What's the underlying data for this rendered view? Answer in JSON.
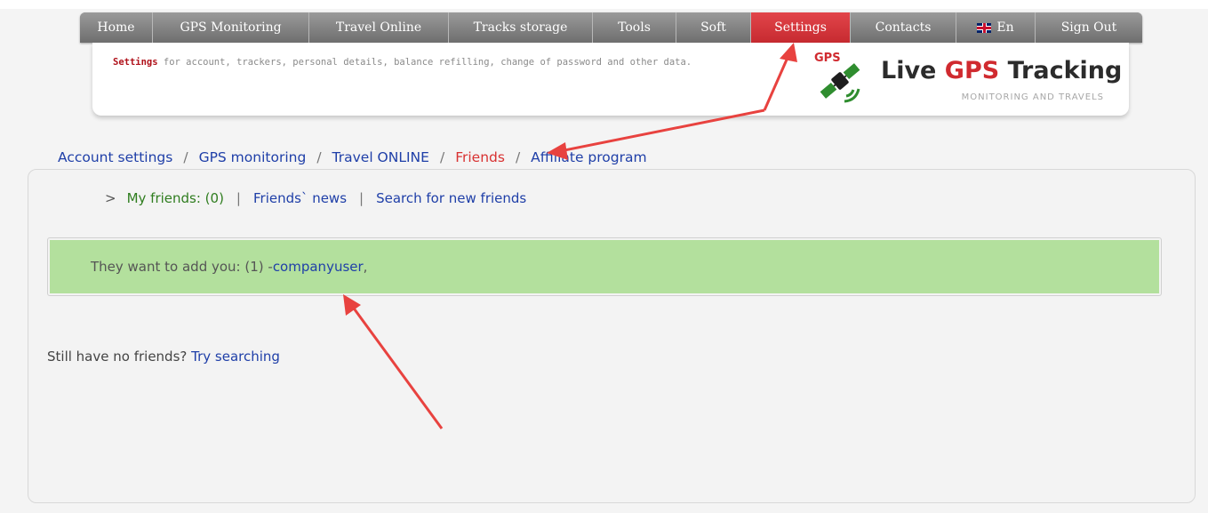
{
  "nav": {
    "items": [
      {
        "label": "Home",
        "active": false
      },
      {
        "label": "GPS Monitoring",
        "active": false
      },
      {
        "label": "Travel Online",
        "active": false
      },
      {
        "label": "Tracks storage",
        "active": false
      },
      {
        "label": "Tools",
        "active": false
      },
      {
        "label": "Soft",
        "active": false
      },
      {
        "label": "Settings",
        "active": true
      },
      {
        "label": "Contacts",
        "active": false
      },
      {
        "label": "En",
        "active": false,
        "icon": "uk-flag-icon"
      },
      {
        "label": "Sign Out",
        "active": false
      }
    ]
  },
  "header": {
    "desc_bold": "Settings",
    "desc_rest": " for account, trackers, personal details, balance refilling, change of password and other data.",
    "logo_gps": "GPS",
    "logo_title_1": "Live ",
    "logo_title_2": "GPS",
    "logo_title_3": " Tracking",
    "logo_sub": "MONITORING AND TRAVELS"
  },
  "breadcrumb": {
    "items": [
      "Account settings",
      "GPS monitoring",
      "Travel ONLINE",
      "Friends",
      "Affiliate program"
    ],
    "separator": "/",
    "active": "Friends"
  },
  "subnav": {
    "marker": ">",
    "my_friends": "My friends: (0)",
    "news": "Friends` news",
    "search": "Search for new friends",
    "separator": "|"
  },
  "notice": {
    "text": "They want to add you: (1) - ",
    "user": "companyuser",
    "suffix": ","
  },
  "empty": {
    "text": "Still have no friends? ",
    "link": "Try searching"
  },
  "colors": {
    "accent": "#d02a2f",
    "link": "#1f3fa8",
    "notice_bg": "#b3e09d",
    "annotation_arrow": "#e8423f"
  },
  "icons": [
    "uk-flag-icon",
    "gps-satellite-logo-icon",
    "annotation-arrow-icon"
  ]
}
